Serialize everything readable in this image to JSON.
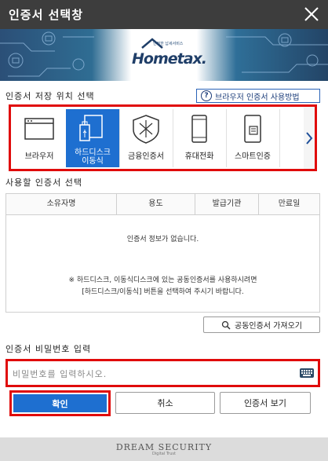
{
  "window": {
    "title": "인증서 선택창"
  },
  "banner": {
    "logo_sub": "안전한 납세서비스",
    "logo_text": "Hometax."
  },
  "storage": {
    "label": "인증서 저장 위치 선택",
    "help_button": "브라우저 인증서 사용방법",
    "items": [
      {
        "label": "브라우저",
        "icon": "browser-window-icon"
      },
      {
        "label": "하드디스크\n이동식",
        "icon": "usb-drive-icon",
        "selected": true
      },
      {
        "label": "금융인증서",
        "icon": "financial-cert-icon"
      },
      {
        "label": "휴대전화",
        "icon": "mobile-phone-icon"
      },
      {
        "label": "스마트인증",
        "icon": "smart-cert-icon"
      }
    ]
  },
  "certs": {
    "label": "사용할 인증서 선택",
    "columns": [
      "소유자명",
      "용도",
      "발급기관",
      "만료일"
    ],
    "empty_message": "인증서 정보가 없습니다.",
    "note_line1": "※ 하드디스크, 이동식디스크에 있는 공동인증서를 사용하시려면",
    "note_line2": "[하드디스크/이동식] 버튼을 선택하여 주시기 바랍니다.",
    "import_button": "공동인증서 가져오기"
  },
  "password": {
    "label": "인증서 비밀번호 입력",
    "placeholder": "비밀번호를 입력하시오."
  },
  "actions": {
    "confirm": "확인",
    "cancel": "취소",
    "view": "인증서 보기"
  },
  "footer": {
    "brand": "DREAM SECURITY",
    "tagline": "Digital Trust"
  },
  "colors": {
    "accent": "#1e6fd0",
    "highlight": "#e00b0b",
    "titlebar": "#3d3d3d"
  }
}
